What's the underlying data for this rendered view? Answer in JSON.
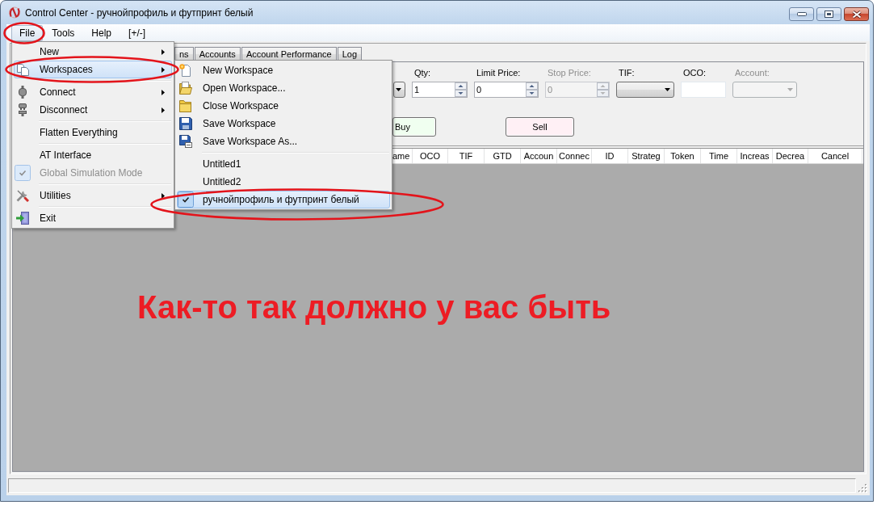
{
  "window": {
    "title": "Control Center - ручнойпрофиль и футпринт белый"
  },
  "menu_bar": [
    {
      "label": "File",
      "selected": true
    },
    {
      "label": "Tools",
      "selected": false
    },
    {
      "label": "Help",
      "selected": false
    },
    {
      "label": "[+/-]",
      "selected": false
    }
  ],
  "tabs": [
    {
      "label": "ns",
      "selected": false
    },
    {
      "label": "Accounts",
      "selected": false
    },
    {
      "label": "Account Performance",
      "selected": false
    },
    {
      "label": "Log",
      "selected": false
    }
  ],
  "order_entry": {
    "fields": [
      {
        "kind": "combo",
        "disabled": false
      },
      {
        "kind": "spinner",
        "label": "Qty:",
        "value": "1",
        "disabled": false
      },
      {
        "kind": "spinner",
        "label": "Limit Price:",
        "value": "0",
        "disabled": false
      },
      {
        "kind": "spinner",
        "label": "Stop Price:",
        "value": "0",
        "disabled": true
      },
      {
        "kind": "combo",
        "label": "TIF:",
        "disabled": false
      },
      {
        "kind": "text",
        "label": "OCO:",
        "disabled": false
      },
      {
        "kind": "combo",
        "label": "Account:",
        "disabled": true
      }
    ],
    "buttons": [
      {
        "label": "Buy",
        "color": "#f0fff0"
      },
      {
        "label": "Sell",
        "color": "#fff0f5"
      }
    ]
  },
  "columns": [
    "ame",
    "OCO",
    "TIF",
    "GTD",
    "Accoun",
    "Connec",
    "ID",
    "Strateg",
    "Token",
    "Time",
    "Increas",
    "Decrea",
    "Cancel"
  ],
  "annotation": {
    "text": "Как-то так должно у вас быть"
  },
  "file_menu": [
    {
      "kind": "item",
      "label": "New",
      "submenu": true,
      "selected": false,
      "disabled": false,
      "checked": false
    },
    {
      "kind": "item",
      "label": "Workspaces",
      "submenu": true,
      "selected": true,
      "disabled": false,
      "checked": false
    },
    {
      "kind": "separator"
    },
    {
      "kind": "item",
      "label": "Connect",
      "submenu": true,
      "selected": false,
      "disabled": false,
      "checked": false
    },
    {
      "kind": "item",
      "label": "Disconnect",
      "submenu": true,
      "selected": false,
      "disabled": false,
      "checked": false
    },
    {
      "kind": "separator"
    },
    {
      "kind": "item",
      "label": "Flatten Everything",
      "submenu": false,
      "selected": false,
      "disabled": false,
      "checked": false
    },
    {
      "kind": "separator"
    },
    {
      "kind": "item",
      "label": "AT Interface",
      "submenu": false,
      "selected": false,
      "disabled": false,
      "checked": false
    },
    {
      "kind": "item",
      "label": "Global Simulation Mode",
      "submenu": false,
      "selected": false,
      "disabled": true,
      "checked": true
    },
    {
      "kind": "separator"
    },
    {
      "kind": "item",
      "label": "Utilities",
      "submenu": true,
      "selected": false,
      "disabled": false,
      "checked": false
    },
    {
      "kind": "separator"
    },
    {
      "kind": "item",
      "label": "Exit",
      "submenu": false,
      "selected": false,
      "disabled": false,
      "checked": false
    }
  ],
  "workspaces_menu": [
    {
      "kind": "item",
      "label": "New Workspace",
      "selected": false,
      "checked": false
    },
    {
      "kind": "item",
      "label": "Open Workspace...",
      "selected": false,
      "checked": false
    },
    {
      "kind": "item",
      "label": "Close Workspace",
      "selected": false,
      "checked": false
    },
    {
      "kind": "item",
      "label": "Save Workspace",
      "selected": false,
      "checked": false
    },
    {
      "kind": "item",
      "label": "Save Workspace As...",
      "selected": false,
      "checked": false
    },
    {
      "kind": "separator"
    },
    {
      "kind": "item",
      "label": "Untitled1",
      "selected": false,
      "checked": false
    },
    {
      "kind": "item",
      "label": "Untitled2",
      "selected": false,
      "checked": false
    },
    {
      "kind": "item",
      "label": "ручнойпрофиль и футпринт белый",
      "selected": true,
      "checked": true
    }
  ]
}
